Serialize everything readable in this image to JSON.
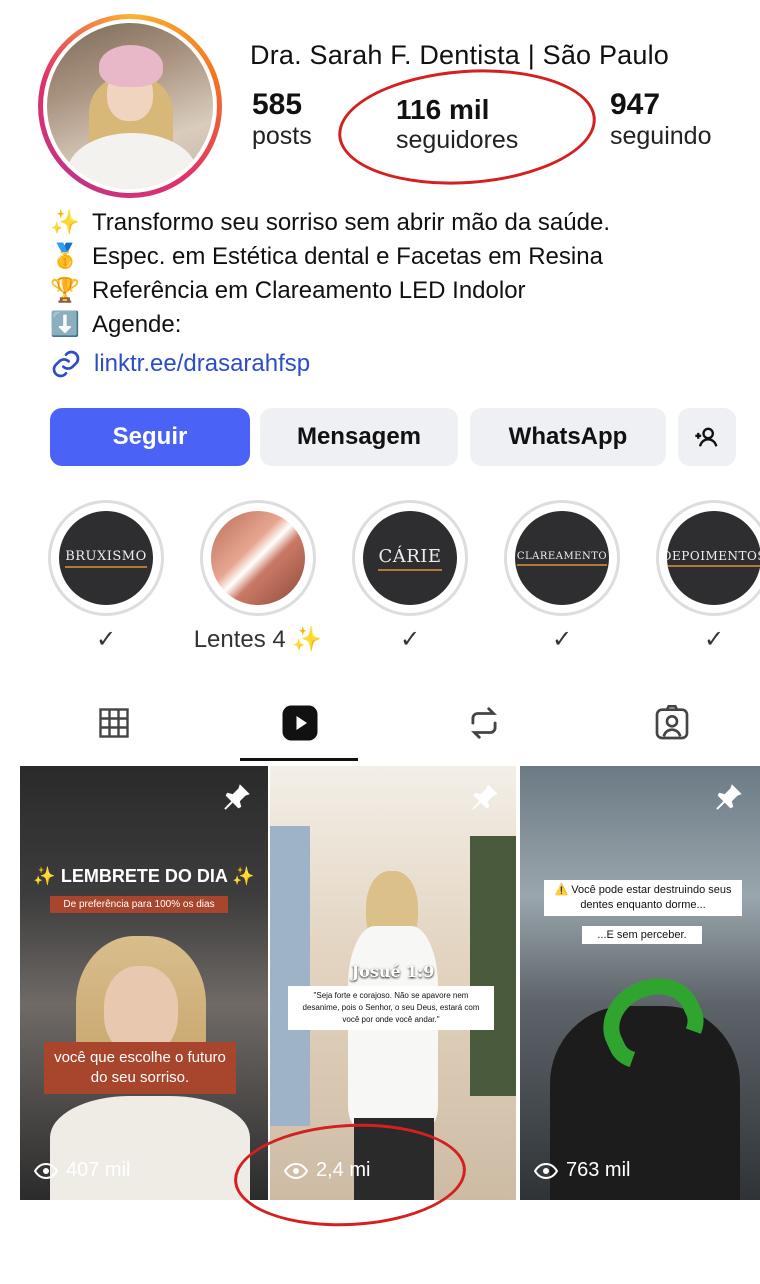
{
  "profile": {
    "name": "Dra. Sarah F. Dentista  | São Paulo",
    "stats": [
      {
        "value": "585",
        "label": "posts"
      },
      {
        "value": "116 mil",
        "label": "seguidores"
      },
      {
        "value": "947",
        "label": "seguindo"
      }
    ]
  },
  "bio": [
    {
      "emoji": "✨",
      "text": "Transformo seu sorriso sem abrir mão da saúde."
    },
    {
      "emoji": "🥇",
      "text": "Espec. em Estética dental e Facetas em Resina"
    },
    {
      "emoji": "🏆",
      "text": "Referência em Clareamento LED Indolor"
    },
    {
      "emoji": "⬇️",
      "text": "Agende:"
    }
  ],
  "link": "linktr.ee/drasarahfsp",
  "buttons": {
    "follow": "Seguir",
    "message": "Mensagem",
    "whatsapp": "WhatsApp"
  },
  "highlights": [
    {
      "title": "BRUXISMO",
      "caption": "✓"
    },
    {
      "title": "",
      "caption": "Lentes 4 ✨"
    },
    {
      "title": "CÁRIE",
      "caption": "✓"
    },
    {
      "title": "CLAREAMENTO",
      "caption": "✓"
    },
    {
      "title": "DEPOIMENTOS",
      "caption": "✓"
    }
  ],
  "tabs": [
    "grid-icon",
    "reels-icon",
    "reposts-icon",
    "tagged-icon"
  ],
  "reels": [
    {
      "views": "407 mil",
      "title": "✨ LEMBRETE DO DIA ✨",
      "subtitle": "De preferência para 100% os dias",
      "caption": "você que escolhe o futuro do seu sorriso."
    },
    {
      "views": "2,4 mi",
      "title": "Josué 1:9",
      "quote": "\"Seja forte e corajoso. Não se apavore nem desanime, pois o Senhor, o seu Deus, estará com você por onde você andar.\""
    },
    {
      "views": "763 mil",
      "line1": "⚠️ Você pode estar destruindo seus dentes enquanto dorme...",
      "line2": "...E sem perceber."
    }
  ],
  "colors": {
    "primary": "#4a62f5",
    "annotation": "#d42020",
    "link": "#2d4cc8"
  }
}
